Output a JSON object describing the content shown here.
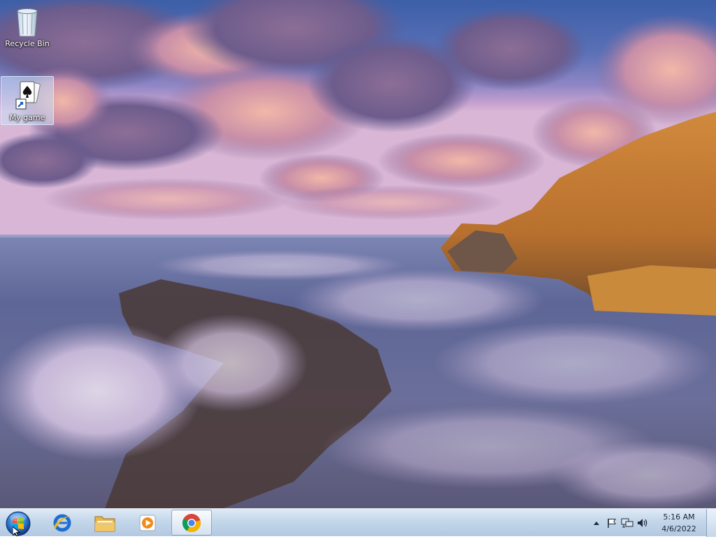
{
  "desktop": {
    "icons": [
      {
        "label": "Recycle Bin",
        "icon": "recycle-bin-icon",
        "selected": false
      },
      {
        "label": "My game",
        "icon": "solitaire-shortcut-icon",
        "selected": true
      }
    ]
  },
  "taskbar": {
    "start_icon": "windows-start-orb-icon",
    "pinned": [
      {
        "icon": "internet-explorer-icon",
        "active": false
      },
      {
        "icon": "windows-explorer-icon",
        "active": false
      },
      {
        "icon": "windows-media-player-icon",
        "active": false
      },
      {
        "icon": "google-chrome-icon",
        "active": true
      }
    ],
    "tray": {
      "icons": [
        "show-hidden-icons-icon",
        "action-center-flag-icon",
        "network-icon",
        "volume-icon"
      ],
      "time": "5:16 AM",
      "date": "4/6/2022"
    }
  },
  "colors": {
    "taskbar_top": "#dfeaf5",
    "taskbar_bottom": "#b3c9e1",
    "start_orb": "#2f7ed8"
  }
}
